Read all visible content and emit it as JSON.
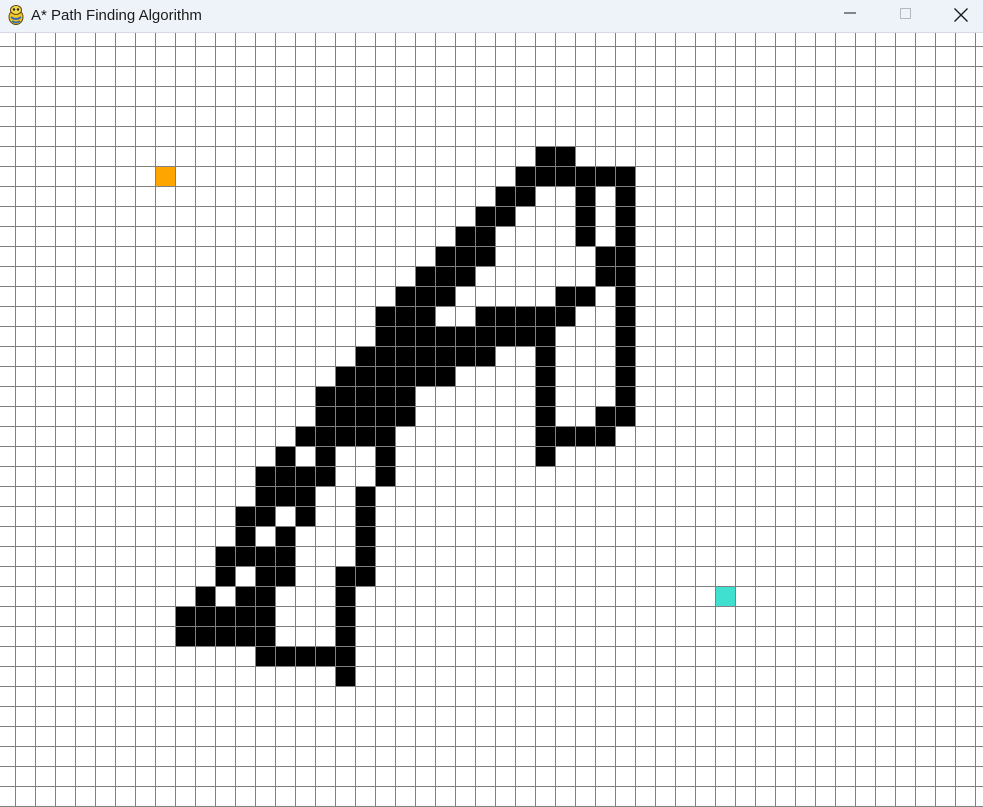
{
  "window": {
    "title": "A* Path Finding Algorithm",
    "icon": "pygame-snake-icon",
    "controls": [
      "minimize-icon",
      "maximize-icon",
      "close-icon"
    ]
  },
  "grid": {
    "columns": 50,
    "rows": 39,
    "colors": {
      "background": "#ffffff",
      "gridline": "#808080",
      "barrier": "#000000",
      "start": "#ffa500",
      "end": "#40e0d0"
    },
    "start": {
      "col": 8,
      "row": 8
    },
    "end": {
      "col": 36,
      "row": 29
    },
    "barriers": [
      [
        27,
        7
      ],
      [
        28,
        7
      ],
      [
        26,
        8
      ],
      [
        27,
        8
      ],
      [
        28,
        8
      ],
      [
        29,
        8
      ],
      [
        30,
        8
      ],
      [
        31,
        8
      ],
      [
        25,
        9
      ],
      [
        26,
        9
      ],
      [
        29,
        9
      ],
      [
        31,
        9
      ],
      [
        24,
        10
      ],
      [
        25,
        10
      ],
      [
        29,
        10
      ],
      [
        31,
        10
      ],
      [
        23,
        11
      ],
      [
        24,
        11
      ],
      [
        29,
        11
      ],
      [
        31,
        11
      ],
      [
        22,
        12
      ],
      [
        23,
        12
      ],
      [
        24,
        12
      ],
      [
        30,
        12
      ],
      [
        31,
        12
      ],
      [
        21,
        13
      ],
      [
        22,
        13
      ],
      [
        23,
        13
      ],
      [
        30,
        13
      ],
      [
        31,
        13
      ],
      [
        20,
        14
      ],
      [
        21,
        14
      ],
      [
        22,
        14
      ],
      [
        28,
        14
      ],
      [
        29,
        14
      ],
      [
        31,
        14
      ],
      [
        19,
        15
      ],
      [
        20,
        15
      ],
      [
        21,
        15
      ],
      [
        24,
        15
      ],
      [
        25,
        15
      ],
      [
        26,
        15
      ],
      [
        27,
        15
      ],
      [
        28,
        15
      ],
      [
        31,
        15
      ],
      [
        19,
        16
      ],
      [
        20,
        16
      ],
      [
        21,
        16
      ],
      [
        22,
        16
      ],
      [
        23,
        16
      ],
      [
        24,
        16
      ],
      [
        25,
        16
      ],
      [
        26,
        16
      ],
      [
        27,
        16
      ],
      [
        31,
        16
      ],
      [
        18,
        17
      ],
      [
        19,
        17
      ],
      [
        20,
        17
      ],
      [
        21,
        17
      ],
      [
        22,
        17
      ],
      [
        23,
        17
      ],
      [
        24,
        17
      ],
      [
        27,
        17
      ],
      [
        31,
        17
      ],
      [
        17,
        18
      ],
      [
        18,
        18
      ],
      [
        19,
        18
      ],
      [
        20,
        18
      ],
      [
        21,
        18
      ],
      [
        22,
        18
      ],
      [
        27,
        18
      ],
      [
        31,
        18
      ],
      [
        16,
        19
      ],
      [
        17,
        19
      ],
      [
        18,
        19
      ],
      [
        19,
        19
      ],
      [
        20,
        19
      ],
      [
        27,
        19
      ],
      [
        31,
        19
      ],
      [
        16,
        20
      ],
      [
        17,
        20
      ],
      [
        18,
        20
      ],
      [
        19,
        20
      ],
      [
        20,
        20
      ],
      [
        27,
        20
      ],
      [
        30,
        20
      ],
      [
        31,
        20
      ],
      [
        15,
        21
      ],
      [
        16,
        21
      ],
      [
        17,
        21
      ],
      [
        18,
        21
      ],
      [
        19,
        21
      ],
      [
        27,
        21
      ],
      [
        28,
        21
      ],
      [
        29,
        21
      ],
      [
        30,
        21
      ],
      [
        14,
        22
      ],
      [
        16,
        22
      ],
      [
        19,
        22
      ],
      [
        27,
        22
      ],
      [
        13,
        23
      ],
      [
        14,
        23
      ],
      [
        15,
        23
      ],
      [
        16,
        23
      ],
      [
        19,
        23
      ],
      [
        13,
        24
      ],
      [
        14,
        24
      ],
      [
        15,
        24
      ],
      [
        18,
        24
      ],
      [
        12,
        25
      ],
      [
        13,
        25
      ],
      [
        15,
        25
      ],
      [
        18,
        25
      ],
      [
        12,
        26
      ],
      [
        14,
        26
      ],
      [
        18,
        26
      ],
      [
        11,
        27
      ],
      [
        12,
        27
      ],
      [
        13,
        27
      ],
      [
        14,
        27
      ],
      [
        18,
        27
      ],
      [
        11,
        28
      ],
      [
        13,
        28
      ],
      [
        14,
        28
      ],
      [
        17,
        28
      ],
      [
        18,
        28
      ],
      [
        10,
        29
      ],
      [
        12,
        29
      ],
      [
        13,
        29
      ],
      [
        17,
        29
      ],
      [
        9,
        30
      ],
      [
        10,
        30
      ],
      [
        11,
        30
      ],
      [
        12,
        30
      ],
      [
        13,
        30
      ],
      [
        17,
        30
      ],
      [
        9,
        31
      ],
      [
        10,
        31
      ],
      [
        11,
        31
      ],
      [
        12,
        31
      ],
      [
        13,
        31
      ],
      [
        17,
        31
      ],
      [
        13,
        32
      ],
      [
        14,
        32
      ],
      [
        15,
        32
      ],
      [
        16,
        32
      ],
      [
        17,
        32
      ],
      [
        17,
        33
      ]
    ]
  }
}
